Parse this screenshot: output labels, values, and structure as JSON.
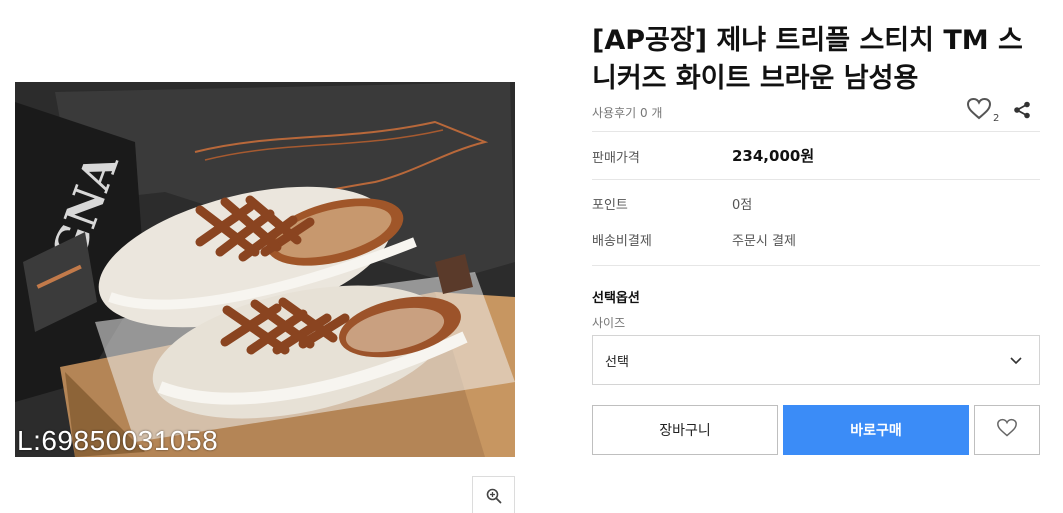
{
  "product": {
    "title": "[AP공장] 제냐 트리플 스티치 TM 스니커즈 화이트 브라운 남성용",
    "review_text": "사용후기 0 개",
    "wish_count": "2",
    "image_watermark": "L:69850031058",
    "image_logo_text": "GNA"
  },
  "info": {
    "price_label": "판매가격",
    "price_value": "234,000원",
    "points_label": "포인트",
    "points_value": "0점",
    "shipping_label": "배송비결제",
    "shipping_value": "주문시 결제"
  },
  "options": {
    "title": "선택옵션",
    "size_label": "사이즈",
    "size_selected": "선택"
  },
  "actions": {
    "cart_label": "장바구니",
    "buy_label": "바로구매"
  },
  "icons": {
    "zoom": "zoom-in-icon",
    "heart": "heart-icon",
    "share": "share-icon",
    "chevron": "chevron-down-icon"
  },
  "colors": {
    "buy_button": "#3b8cf7",
    "leather_brown": "#9c532a",
    "sneaker_cream": "#e7e1d6"
  }
}
